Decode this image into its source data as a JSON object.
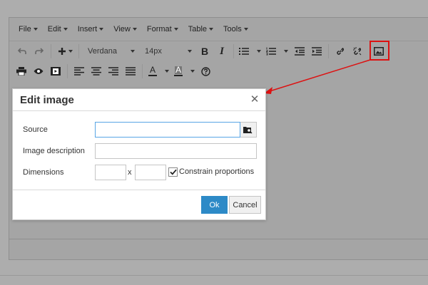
{
  "menubar": {
    "items": [
      {
        "label": "File"
      },
      {
        "label": "Edit"
      },
      {
        "label": "Insert"
      },
      {
        "label": "View"
      },
      {
        "label": "Format"
      },
      {
        "label": "Table"
      },
      {
        "label": "Tools"
      }
    ]
  },
  "toolbar": {
    "font_family": "Verdana",
    "font_size": "14px",
    "bold_label": "B",
    "italic_label": "I",
    "text_color_label": "A",
    "bg_color_label": "A",
    "icons": [
      "undo-icon",
      "redo-icon",
      "insert-plus-icon",
      "bold-icon",
      "italic-icon",
      "bullet-list-icon",
      "numbered-list-icon",
      "outdent-icon",
      "indent-icon",
      "link-icon",
      "unlink-icon",
      "image-icon",
      "print-icon",
      "preview-icon",
      "media-icon",
      "align-left-icon",
      "align-center-icon",
      "align-right-icon",
      "align-justify-icon",
      "text-color-icon",
      "background-color-icon",
      "help-icon"
    ]
  },
  "dialog": {
    "title": "Edit image",
    "close_symbol": "✕",
    "source_label": "Source",
    "source_value": "",
    "description_label": "Image description",
    "description_value": "",
    "dimensions_label": "Dimensions",
    "width_value": "",
    "height_value": "",
    "times_symbol": "x",
    "constrain_label": "Constrain proportions",
    "constrain_checked": true,
    "ok_label": "Ok",
    "cancel_label": "Cancel"
  },
  "colors": {
    "annotation": "#dd1111",
    "ok_button": "#2d8ac7",
    "focus_border": "#59a5e5"
  }
}
